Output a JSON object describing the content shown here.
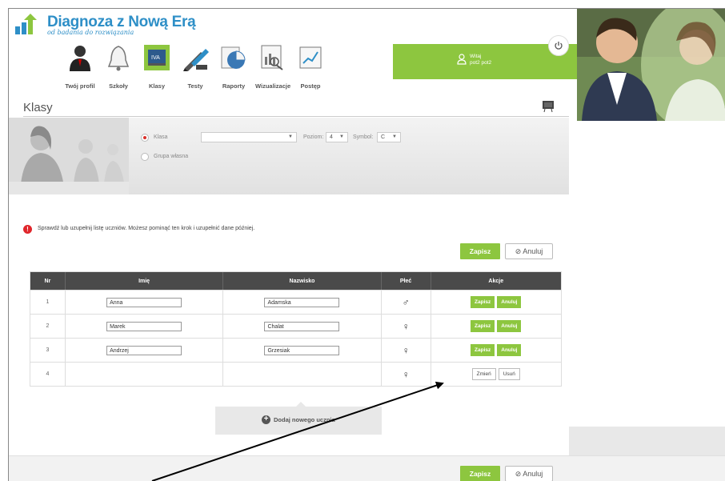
{
  "brand": {
    "title_part1": "Diagnoza",
    "title_part2": "z Nową Erą",
    "subtitle": "od badania do rozwiązania"
  },
  "nav": [
    {
      "label": "Twój profil",
      "icon": "user-icon"
    },
    {
      "label": "Szkoły",
      "icon": "bell-icon"
    },
    {
      "label": "Klasy",
      "icon": "board-icon",
      "active": true
    },
    {
      "label": "Testy",
      "icon": "pencil-icon"
    },
    {
      "label": "Raporty",
      "icon": "pie-chart-icon"
    },
    {
      "label": "Wizualizacje",
      "icon": "chart-icon"
    },
    {
      "label": "Postęp",
      "icon": "progress-chart-icon"
    }
  ],
  "user": {
    "greeting": "Witaj",
    "name": "pot2 pot2"
  },
  "page": {
    "title": "Klasy"
  },
  "filter": {
    "option_class": "Klasa",
    "option_group": "Grupa własna",
    "class_select_value": "",
    "level_label": "Poziom:",
    "level_value": "4",
    "symbol_label": "Symbol:",
    "symbol_value": "C"
  },
  "alert": {
    "icon": "!",
    "text": "Sprawdź lub uzupełnij listę uczniów. Możesz pominąć ten krok i uzupełnić dane później."
  },
  "actions": {
    "save": "Zapisz",
    "cancel": "⊘ Anuluj"
  },
  "table": {
    "headers": [
      "Nr",
      "Imię",
      "Nazwisko",
      "Płeć",
      "Akcje"
    ],
    "rows": [
      {
        "nr": "1",
        "first_name": "Anna",
        "last_name": "Adamska",
        "gender": "♂",
        "btn1": "Zapisz",
        "btn2": "Anuluj",
        "editing": true
      },
      {
        "nr": "2",
        "first_name": "Marek",
        "last_name": "Chalat",
        "gender": "♀",
        "btn1": "Zapisz",
        "btn2": "Anuluj",
        "editing": true
      },
      {
        "nr": "3",
        "first_name": "Andrzej",
        "last_name": "Grzesiak",
        "gender": "♀",
        "btn1": "Zapisz",
        "btn2": "Anuluj",
        "editing": true
      },
      {
        "nr": "4",
        "first_name": "",
        "last_name": "",
        "gender": "♀",
        "btn1": "Zmień",
        "btn2": "Usuń",
        "editing": false
      }
    ]
  },
  "add_student": {
    "icon": "+",
    "label": "Dodaj nowego ucznia"
  },
  "colors": {
    "accent_green": "#8dc63f",
    "brand_blue": "#2e8fc7",
    "alert_red": "#e0262b",
    "table_header": "#4a4a4a"
  }
}
